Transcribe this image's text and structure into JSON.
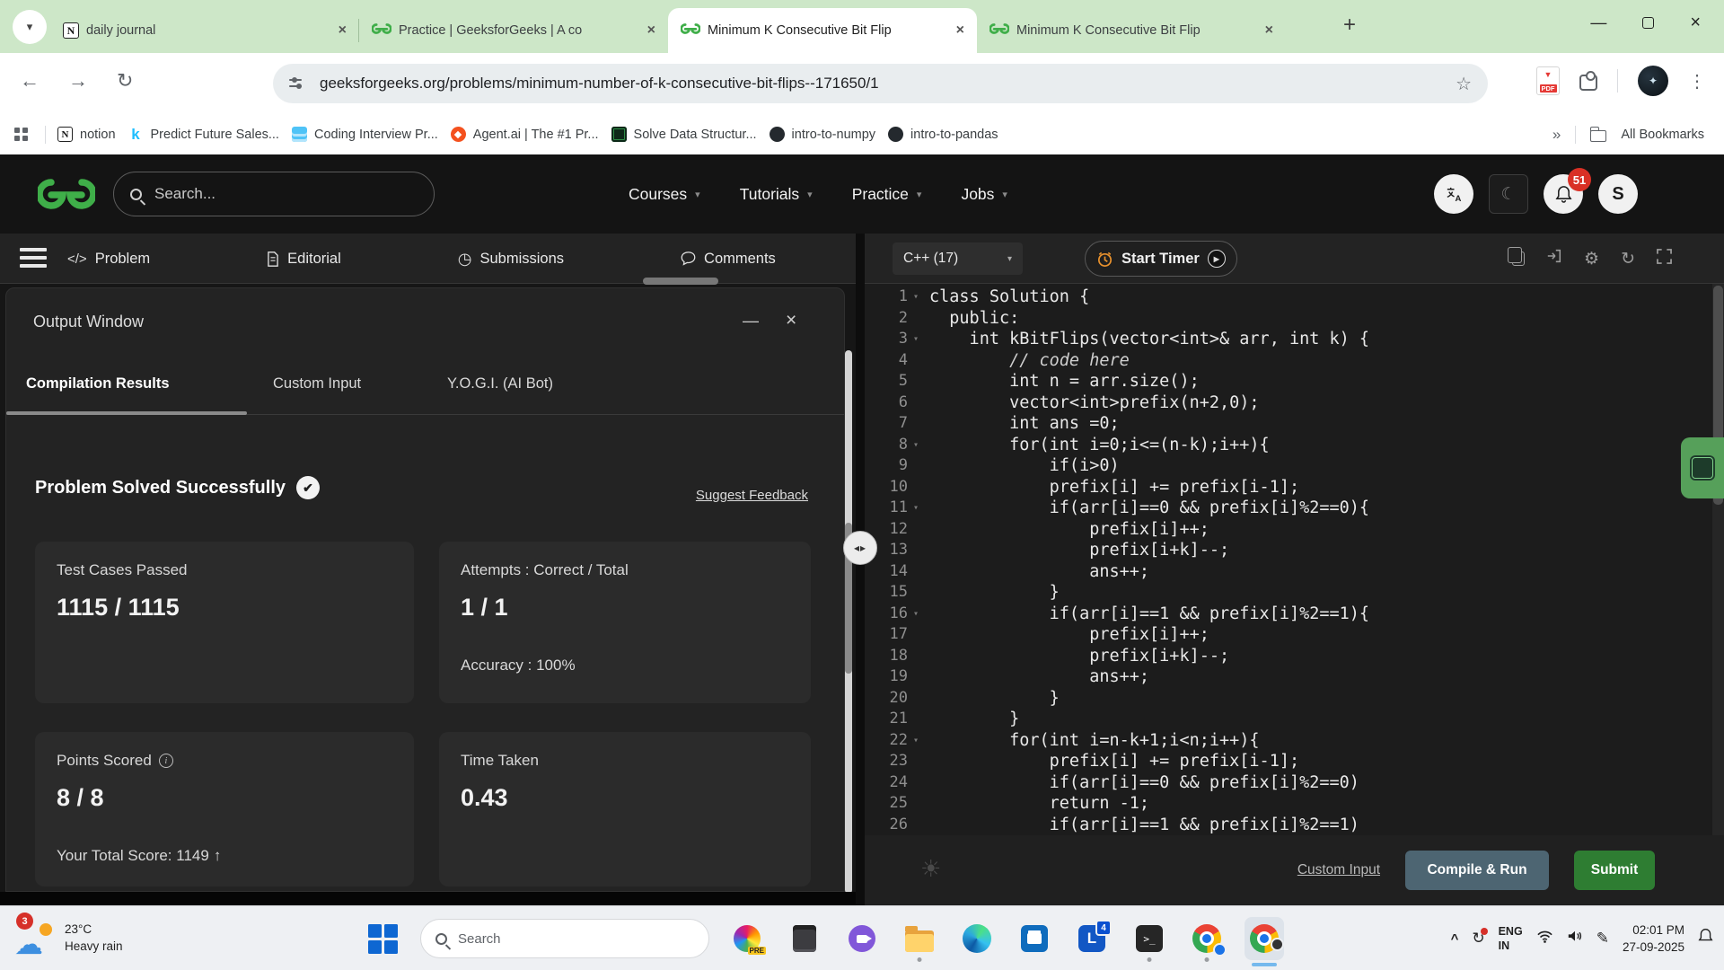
{
  "browser": {
    "tabs": [
      {
        "title": "daily journal",
        "icon": "notion",
        "active": false
      },
      {
        "title": "Practice | GeeksforGeeks | A co",
        "icon": "gfg",
        "active": false
      },
      {
        "title": "Minimum K Consecutive Bit Flip",
        "icon": "gfg",
        "active": true
      },
      {
        "title": "Minimum K Consecutive Bit Flip",
        "icon": "gfg",
        "active": false
      }
    ],
    "url": "geeksforgeeks.org/problems/minimum-number-of-k-consecutive-bit-flips--171650/1",
    "bookmarks": [
      {
        "label": "notion",
        "icon": "notion"
      },
      {
        "label": "Predict Future Sales...",
        "icon": "kaggle"
      },
      {
        "label": "Coding Interview Pr...",
        "icon": "doc-blue"
      },
      {
        "label": "Agent.ai | The #1 Pr...",
        "icon": "agent"
      },
      {
        "label": "Solve Data Structur...",
        "icon": "gfg-dark"
      },
      {
        "label": "intro-to-numpy",
        "icon": "github"
      },
      {
        "label": "intro-to-pandas",
        "icon": "github"
      }
    ],
    "all_bookmarks": "All Bookmarks"
  },
  "gfg_header": {
    "search_placeholder": "Search...",
    "nav": [
      "Courses",
      "Tutorials",
      "Practice",
      "Jobs"
    ],
    "notification_count": "51",
    "avatar_letter": "S"
  },
  "problem_tabs": [
    {
      "label": "Problem",
      "icon": "code"
    },
    {
      "label": "Editorial",
      "icon": "doc"
    },
    {
      "label": "Submissions",
      "icon": "clock"
    },
    {
      "label": "Comments",
      "icon": "bubble"
    }
  ],
  "editor_toolbar": {
    "language": "C++ (17)",
    "start_timer": "Start Timer"
  },
  "output_window": {
    "title": "Output Window",
    "tabs": [
      {
        "label": "Compilation Results",
        "active": true
      },
      {
        "label": "Custom Input",
        "active": false
      },
      {
        "label": "Y.O.G.I. (AI Bot)",
        "active": false
      }
    ],
    "status_heading": "Problem Solved Successfully",
    "suggest_feedback": "Suggest Feedback",
    "cards": {
      "test_cases": {
        "label": "Test Cases Passed",
        "value": "1115 / 1115"
      },
      "attempts": {
        "label": "Attempts : Correct / Total",
        "value": "1 / 1",
        "sub": "Accuracy : 100%"
      },
      "points": {
        "label": "Points Scored",
        "value": "8 / 8",
        "sub": "Your Total Score: 1149",
        "sub_arrow": "↑"
      },
      "time": {
        "label": "Time Taken",
        "value": "0.43"
      }
    }
  },
  "editor_footer": {
    "custom_input": "Custom Input",
    "compile_run": "Compile & Run",
    "submit": "Submit"
  },
  "code": {
    "lines": [
      {
        "n": 1,
        "t": "class Solution {",
        "fold": true
      },
      {
        "n": 2,
        "t": "  public:"
      },
      {
        "n": 3,
        "t": "    int kBitFlips(vector<int>& arr, int k) {",
        "fold": true
      },
      {
        "n": 4,
        "t": "        // code here",
        "comment": true
      },
      {
        "n": 5,
        "t": "        int n = arr.size();"
      },
      {
        "n": 6,
        "t": "        vector<int>prefix(n+2,0);"
      },
      {
        "n": 7,
        "t": "        int ans =0;"
      },
      {
        "n": 8,
        "t": "        for(int i=0;i<=(n-k);i++){",
        "fold": true
      },
      {
        "n": 9,
        "t": "            if(i>0)"
      },
      {
        "n": 10,
        "t": "            prefix[i] += prefix[i-1];"
      },
      {
        "n": 11,
        "t": "            if(arr[i]==0 && prefix[i]%2==0){",
        "fold": true
      },
      {
        "n": 12,
        "t": "                prefix[i]++;"
      },
      {
        "n": 13,
        "t": "                prefix[i+k]--;"
      },
      {
        "n": 14,
        "t": "                ans++;"
      },
      {
        "n": 15,
        "t": "            }"
      },
      {
        "n": 16,
        "t": "            if(arr[i]==1 && prefix[i]%2==1){",
        "fold": true
      },
      {
        "n": 17,
        "t": "                prefix[i]++;"
      },
      {
        "n": 18,
        "t": "                prefix[i+k]--;"
      },
      {
        "n": 19,
        "t": "                ans++;"
      },
      {
        "n": 20,
        "t": "            }"
      },
      {
        "n": 21,
        "t": "        }"
      },
      {
        "n": 22,
        "t": "        for(int i=n-k+1;i<n;i++){",
        "fold": true
      },
      {
        "n": 23,
        "t": "            prefix[i] += prefix[i-1];"
      },
      {
        "n": 24,
        "t": "            if(arr[i]==0 && prefix[i]%2==0)"
      },
      {
        "n": 25,
        "t": "            return -1;"
      },
      {
        "n": 26,
        "t": "            if(arr[i]==1 && prefix[i]%2==1)"
      }
    ]
  },
  "taskbar": {
    "weather": {
      "badge": "3",
      "temp": "23°C",
      "condition": "Heavy rain"
    },
    "search_placeholder": "Search",
    "pre_badge": "PRE",
    "l_badge": "4",
    "lang_line1": "ENG",
    "lang_line2": "IN",
    "time": "02:01 PM",
    "date": "27-09-2025"
  },
  "colors": {
    "accent_green": "#2f8d46",
    "compile_btn": "#4d6572",
    "badge_red": "#d93025"
  }
}
